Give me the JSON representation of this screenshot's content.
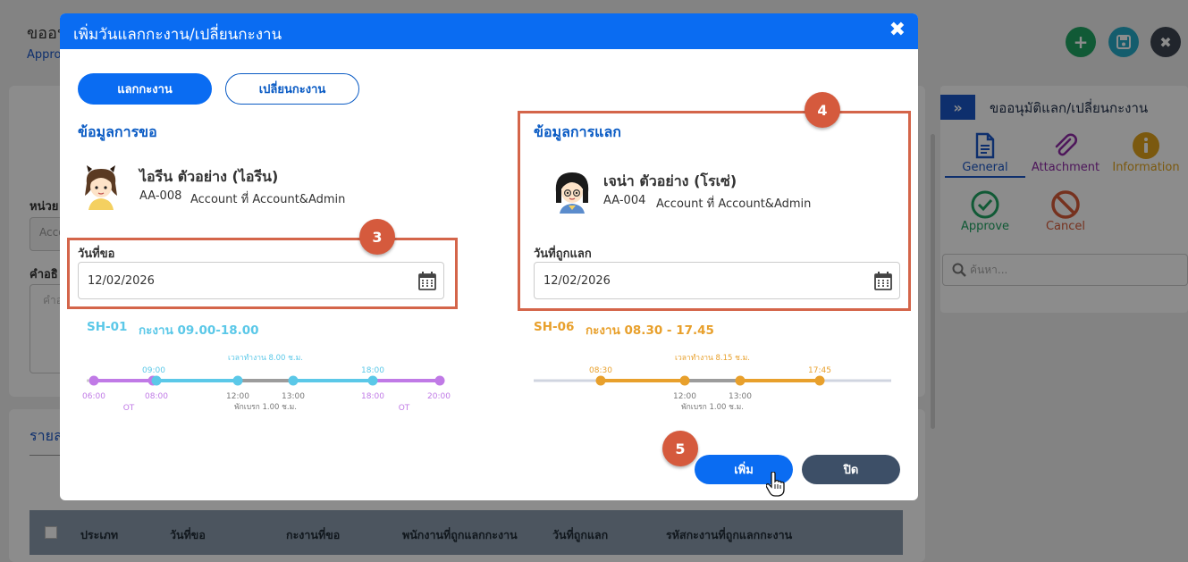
{
  "background": {
    "title": "ขออนุ",
    "subtitle": "Appro",
    "field1_label": "หน่วย",
    "field1_value": "Accou",
    "field2_label": "คำอธิ",
    "field2_placeholder": "คำอ",
    "list_tab": "รายล",
    "table_headers": [
      "ประเภท",
      "วันที่ขอ",
      "กะงานที่ขอ",
      "พนักงานที่ถูกแลกกะงาน",
      "วันที่ถูกแลก",
      "รหัสกะงานที่ถูกแลกกะงาน"
    ]
  },
  "header_buttons": {
    "add": "+",
    "save": "save",
    "close": "✖",
    "colors": {
      "add": "#1fa463",
      "save": "#26a9c7",
      "close": "#3d4450"
    }
  },
  "side_panel": {
    "toggle": "»",
    "title": "ขออนุมัติแลก/เปลี่ยนกะงาน",
    "tabs": [
      {
        "label": "General",
        "icon": "document-icon",
        "color": "#1b57c7"
      },
      {
        "label": "Attachment",
        "icon": "paperclip-icon",
        "color": "#8e2aa6"
      },
      {
        "label": "Information",
        "icon": "info-icon",
        "color": "#e0a31c"
      }
    ],
    "actions": [
      {
        "label": "Approve",
        "icon": "check-circle-icon",
        "color": "#1fa463"
      },
      {
        "label": "Cancel",
        "icon": "ban-icon",
        "color": "#d85b3a"
      }
    ],
    "search_placeholder": "ค้นหา..."
  },
  "modal": {
    "title": "เพิ่มวันแลกกะงาน/เปลี่ยนกะงาน",
    "close_glyph": "✖",
    "tabs": {
      "swap": "แลกกะงาน",
      "change": "เปลี่ยนกะงาน"
    },
    "request": {
      "section_title": "ข้อมูลการขอ",
      "name": "ไอรีน ตัวอย่าง (ไอรีน)",
      "code": "AA-008",
      "position": "Account ที่ Account&Admin",
      "date_label": "วันที่ขอ",
      "date_value": "12/02/2026",
      "shift_code": "SH-01",
      "shift_text": "กะงาน 09.00-18.00",
      "timeline": {
        "work_hours": "เวลาทำงาน 8.00 ช.ม.",
        "break": "พักเบรก 1.00 ช.ม.",
        "ot_label": "OT",
        "times": {
          "t0600": "06:00",
          "t0800": "08:00",
          "t0900": "09:00",
          "t1200": "12:00",
          "t1300": "13:00",
          "t1800": "18:00",
          "t2000": "20:00"
        }
      }
    },
    "swap": {
      "section_title": "ข้อมูลการแลก",
      "name": "เจน่า ตัวอย่าง (โรเซ่)",
      "code": "AA-004",
      "position": "Account ที่ Account&Admin",
      "date_label": "วันที่ถูกแลก",
      "date_value": "12/02/2026",
      "shift_code": "SH-06",
      "shift_text": "กะงาน 08.30 - 17.45",
      "timeline": {
        "work_hours": "เวลาทำงาน 8.15 ช.ม.",
        "break": "พักเบรก 1.00 ช.ม.",
        "times": {
          "t0830": "08:30",
          "t1200": "12:00",
          "t1300": "13:00",
          "t1745": "17:45"
        }
      }
    },
    "buttons": {
      "add": "เพิ่ม",
      "close": "ปิด"
    },
    "badges": {
      "b3": "3",
      "b4": "4",
      "b5": "5"
    },
    "colors": {
      "primary": "#0a6cf2",
      "request_shift": "#5bc8e8",
      "swap_shift": "#e8a02c",
      "ot": "#c07ae6",
      "highlight": "#d4654a"
    }
  }
}
